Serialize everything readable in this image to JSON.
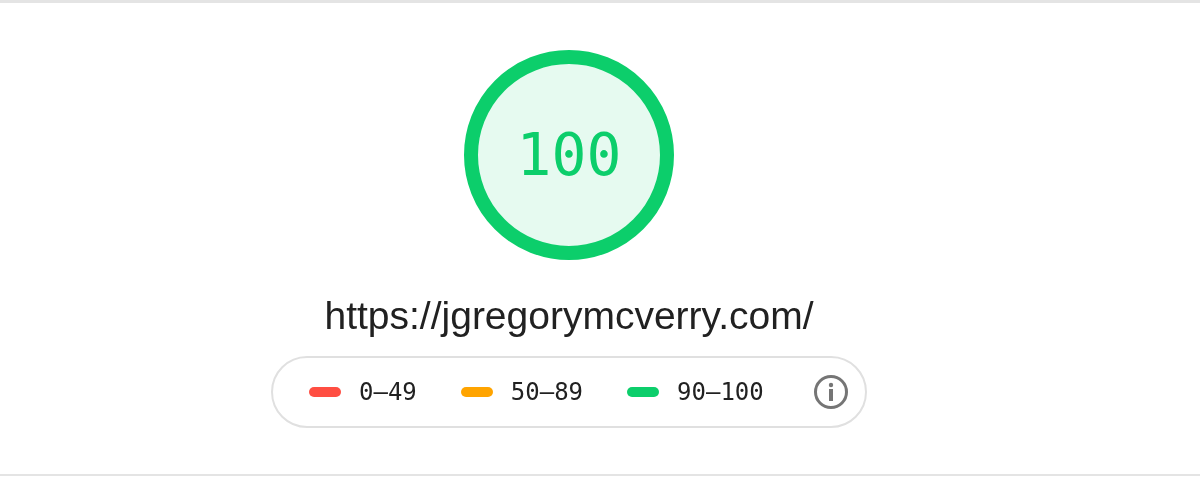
{
  "gauge": {
    "score": "100",
    "color": "#0cce6b"
  },
  "url": "https://jgregorymcverry.com/",
  "legend": [
    {
      "label": "0–49",
      "color": "#ff4e42"
    },
    {
      "label": "50–89",
      "color": "#ffa400"
    },
    {
      "label": "90–100",
      "color": "#0cce6b"
    }
  ]
}
